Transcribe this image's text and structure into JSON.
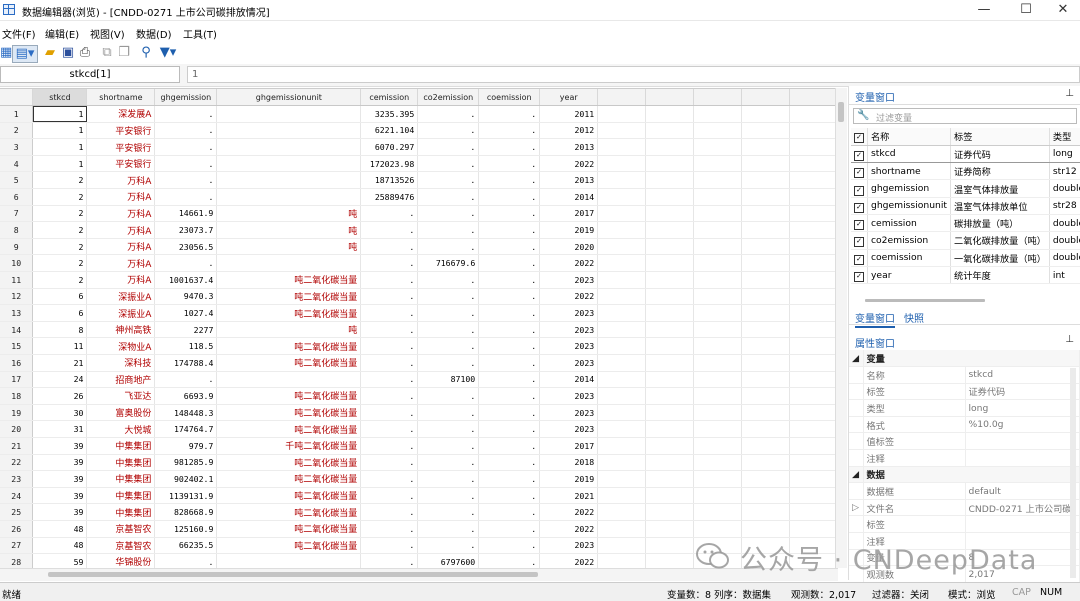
{
  "window": {
    "title": "数据编辑器(浏览) - [CNDD-0271 上市公司碳排放情况]",
    "min": "—",
    "max": "☐",
    "close": "✕"
  },
  "menu": [
    "文件(F)",
    "编辑(E)",
    "视图(V)",
    "数据(D)",
    "工具(T)"
  ],
  "formula": {
    "name": "stkcd[1]",
    "value": "1"
  },
  "columns": [
    "stkcd",
    "shortname",
    "ghgemission",
    "ghgemissionunit",
    "cemission",
    "co2emission",
    "coemission",
    "year"
  ],
  "rows": [
    [
      "1",
      "1",
      "深发展A",
      ".",
      "",
      "3235.395",
      ".",
      ".",
      "2011"
    ],
    [
      "2",
      "1",
      "平安银行",
      ".",
      "",
      "6221.104",
      ".",
      ".",
      "2012"
    ],
    [
      "3",
      "1",
      "平安银行",
      ".",
      "",
      "6070.297",
      ".",
      ".",
      "2013"
    ],
    [
      "4",
      "1",
      "平安银行",
      ".",
      "",
      "172023.98",
      ".",
      ".",
      "2022"
    ],
    [
      "5",
      "2",
      "万科A",
      ".",
      "",
      "18713526",
      ".",
      ".",
      "2013"
    ],
    [
      "6",
      "2",
      "万科A",
      ".",
      "",
      "25889476",
      ".",
      ".",
      "2014"
    ],
    [
      "7",
      "2",
      "万科A",
      "14661.9",
      "吨",
      ".",
      ".",
      ".",
      "2017"
    ],
    [
      "8",
      "2",
      "万科A",
      "23073.7",
      "吨",
      ".",
      ".",
      ".",
      "2019"
    ],
    [
      "9",
      "2",
      "万科A",
      "23056.5",
      "吨",
      ".",
      ".",
      ".",
      "2020"
    ],
    [
      "10",
      "2",
      "万科A",
      ".",
      "",
      ".",
      "716679.6",
      ".",
      "2022"
    ],
    [
      "11",
      "2",
      "万科A",
      "1001637.4",
      "吨二氧化碳当量",
      ".",
      ".",
      ".",
      "2023"
    ],
    [
      "12",
      "6",
      "深振业A",
      "9470.3",
      "吨二氧化碳当量",
      ".",
      ".",
      ".",
      "2022"
    ],
    [
      "13",
      "6",
      "深振业A",
      "1027.4",
      "吨二氧化碳当量",
      ".",
      ".",
      ".",
      "2023"
    ],
    [
      "14",
      "8",
      "神州高铁",
      "2277",
      "吨",
      ".",
      ".",
      ".",
      "2023"
    ],
    [
      "15",
      "11",
      "深物业A",
      "118.5",
      "吨二氧化碳当量",
      ".",
      ".",
      ".",
      "2023"
    ],
    [
      "16",
      "21",
      "深科技",
      "174788.4",
      "吨二氧化碳当量",
      ".",
      ".",
      ".",
      "2023"
    ],
    [
      "17",
      "24",
      "招商地产",
      ".",
      "",
      ".",
      "87100",
      ".",
      "2014"
    ],
    [
      "18",
      "26",
      "飞亚达",
      "6693.9",
      "吨二氧化碳当量",
      ".",
      ".",
      ".",
      "2023"
    ],
    [
      "19",
      "30",
      "富奥股份",
      "148448.3",
      "吨二氧化碳当量",
      ".",
      ".",
      ".",
      "2023"
    ],
    [
      "20",
      "31",
      "大悦城",
      "174764.7",
      "吨二氧化碳当量",
      ".",
      ".",
      ".",
      "2023"
    ],
    [
      "21",
      "39",
      "中集集团",
      "979.7",
      "千吨二氧化碳当量",
      ".",
      ".",
      ".",
      "2017"
    ],
    [
      "22",
      "39",
      "中集集团",
      "981285.9",
      "吨二氧化碳当量",
      ".",
      ".",
      ".",
      "2018"
    ],
    [
      "23",
      "39",
      "中集集团",
      "902402.1",
      "吨二氧化碳当量",
      ".",
      ".",
      ".",
      "2019"
    ],
    [
      "24",
      "39",
      "中集集团",
      "1139131.9",
      "吨二氧化碳当量",
      ".",
      ".",
      ".",
      "2021"
    ],
    [
      "25",
      "39",
      "中集集团",
      "828668.9",
      "吨二氧化碳当量",
      ".",
      ".",
      ".",
      "2022"
    ],
    [
      "26",
      "48",
      "京基智农",
      "125160.9",
      "吨二氧化碳当量",
      ".",
      ".",
      ".",
      "2022"
    ],
    [
      "27",
      "48",
      "京基智农",
      "66235.5",
      "吨二氧化碳当量",
      ".",
      ".",
      ".",
      "2023"
    ],
    [
      "28",
      "59",
      "华锦股份",
      ".",
      "",
      ".",
      "6797600",
      ".",
      "2022"
    ]
  ],
  "var_panel": {
    "title": "变量窗口",
    "filter_placeholder": "过滤变量",
    "headers": [
      "名称",
      "标签",
      "类型"
    ],
    "vars": [
      [
        "stkcd",
        "证券代码",
        "long"
      ],
      [
        "shortname",
        "证券简称",
        "str12"
      ],
      [
        "ghgemission",
        "温室气体排放量",
        "double"
      ],
      [
        "ghgemissionunit",
        "温室气体排放单位",
        "str28"
      ],
      [
        "cemission",
        "碳排放量（吨）",
        "double"
      ],
      [
        "co2emission",
        "二氧化碳排放量（吨）",
        "double"
      ],
      [
        "coemission",
        "一氧化碳排放量（吨）",
        "double"
      ],
      [
        "year",
        "统计年度",
        "int"
      ]
    ],
    "tabs": [
      "变量窗口",
      "快照"
    ]
  },
  "prop_panel": {
    "title": "属性窗口",
    "groups": [
      {
        "name": "变量",
        "items": [
          [
            "名称",
            "stkcd"
          ],
          [
            "标签",
            "证券代码"
          ],
          [
            "类型",
            "long"
          ],
          [
            "格式",
            "%10.0g"
          ],
          [
            "值标签",
            ""
          ],
          [
            "注释",
            ""
          ]
        ]
      },
      {
        "name": "数据",
        "items": [
          [
            "数据框",
            "default"
          ],
          [
            "文件名",
            "CNDD-0271 上市公司碳"
          ],
          [
            "标签",
            ""
          ],
          [
            "注释",
            ""
          ],
          [
            "变量",
            "8"
          ],
          [
            "观测数",
            "2,017"
          ]
        ]
      }
    ]
  },
  "status": {
    "left": "就绪",
    "vars": "变量数：8",
    "order": "列序：数据集",
    "obs": "观测数：2,017",
    "filter": "过滤器：关闭",
    "mode": "模式：浏览",
    "cap": "CAP",
    "num": "NUM"
  },
  "watermark": "公众号 · CNDeepData"
}
